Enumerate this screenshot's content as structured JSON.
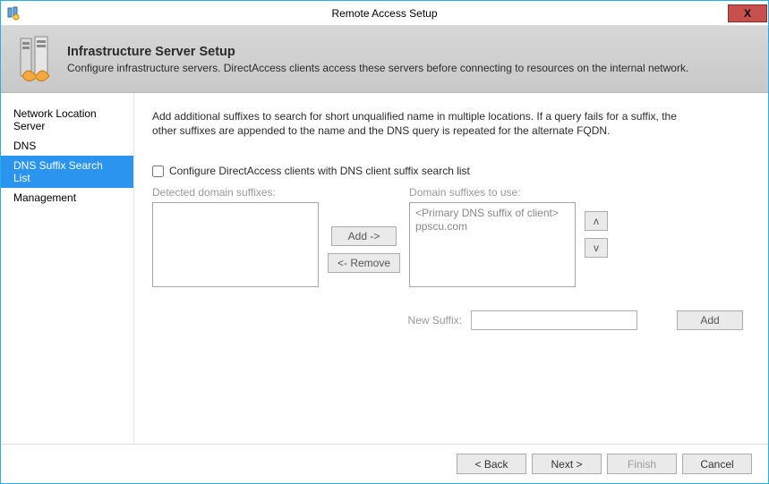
{
  "window": {
    "title": "Remote Access Setup",
    "close_x": "X"
  },
  "header": {
    "title": "Infrastructure Server Setup",
    "subtitle": "Configure infrastructure servers. DirectAccess clients access these servers before connecting to resources on the internal network."
  },
  "sidebar": {
    "items": [
      {
        "label": "Network Location Server",
        "selected": false
      },
      {
        "label": "DNS",
        "selected": false
      },
      {
        "label": "DNS Suffix Search List",
        "selected": true
      },
      {
        "label": "Management",
        "selected": false
      }
    ]
  },
  "content": {
    "intro": "Add additional suffixes to search for short unqualified name in multiple locations. If a query fails for a suffix, the other suffixes are appended to the name and the DNS query is repeated for the alternate FQDN.",
    "checkbox_label": "Configure DirectAccess clients with DNS client suffix search list",
    "checkbox_checked": false,
    "detected_label": "Detected domain suffixes:",
    "touse_label": "Domain suffixes to use:",
    "detected_items": [],
    "touse_items": [
      "<Primary DNS suffix of client>",
      "ppscu.com"
    ],
    "add_btn": "Add ->",
    "remove_btn": "<- Remove",
    "up": "ᴧ",
    "down": "ᴠ",
    "newsuffix_label": "New Suffix:",
    "newsuffix_value": "",
    "newsuffix_add": "Add"
  },
  "footer": {
    "back": "< Back",
    "next": "Next >",
    "finish": "Finish",
    "cancel": "Cancel"
  }
}
